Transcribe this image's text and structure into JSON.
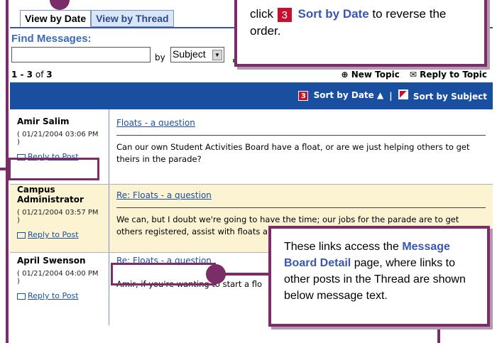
{
  "tabs": [
    {
      "label": "View by Date"
    },
    {
      "label": "View by Thread"
    }
  ],
  "search": {
    "title": "Find Messages:",
    "by_label": "by",
    "selected": "Subject",
    "value": ""
  },
  "list": {
    "range": "1 - 3",
    "of_label": "of",
    "total": "3",
    "new_topic": "New Topic",
    "reply_topic": "Reply to Topic",
    "sort_date": "Sort by Date",
    "sort_subject": "Sort by Subject"
  },
  "messages": [
    {
      "author": "Amir Salim",
      "date": "( 01/21/2004 03:06 PM )",
      "reply": "Reply to Post",
      "subject": "Floats - a question",
      "body": "Can our own Student Activities Board have a float, or are we just helping others to get theirs in the parade?"
    },
    {
      "author": "Campus Administrator",
      "date": "( 01/21/2004 03:57 PM )",
      "reply": "Reply to Post",
      "subject": "Re: Floats - a question",
      "body": "We can, but I doubt we're going to have the time; our jobs for the parade are to get others registered, assist with floats and do the paperwork that comes"
    },
    {
      "author": "April Swenson",
      "date": "( 01/21/2004 04:00 PM )",
      "reply": "Reply to Post",
      "subject": "Re: Floats - a question",
      "body": "Amir, if you're wanting to start a flo"
    }
  ],
  "callout_top": {
    "pre": "click",
    "link": "Sort by Date",
    "post": "to reverse the order."
  },
  "callout_bottom": {
    "pre": "These links access the",
    "link": "Message Board Detail",
    "post": "page, where links to other posts in the Thread are shown below message text."
  },
  "colors": {
    "accent": "#7b2d68",
    "header_bar": "#1a4fa0",
    "alt_row": "#fbf3d2"
  }
}
